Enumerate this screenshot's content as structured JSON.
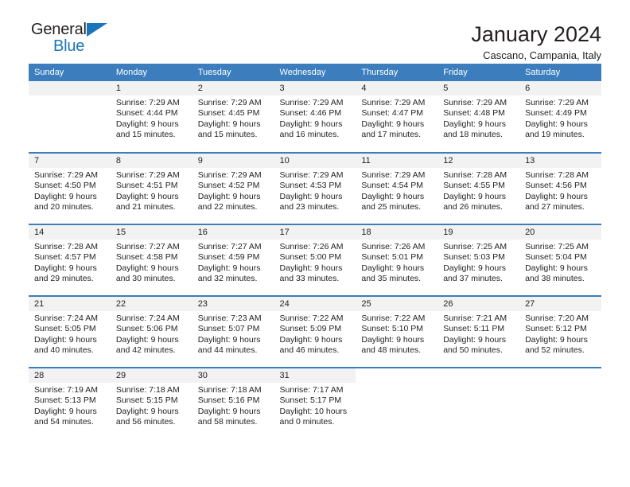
{
  "brand": {
    "name_part1": "General",
    "name_part2": "Blue",
    "accent_color": "#1b75bb"
  },
  "header": {
    "title": "January 2024",
    "subtitle": "Cascano, Campania, Italy"
  },
  "calendar": {
    "header_bg": "#3b7dbd",
    "daynum_bg": "#f2f2f2",
    "weekdays": [
      "Sunday",
      "Monday",
      "Tuesday",
      "Wednesday",
      "Thursday",
      "Friday",
      "Saturday"
    ],
    "weeks": [
      [
        {
          "day": "",
          "sunrise": "",
          "sunset": "",
          "daylight_line1": "",
          "daylight_line2": ""
        },
        {
          "day": "1",
          "sunrise": "Sunrise: 7:29 AM",
          "sunset": "Sunset: 4:44 PM",
          "daylight_line1": "Daylight: 9 hours",
          "daylight_line2": "and 15 minutes."
        },
        {
          "day": "2",
          "sunrise": "Sunrise: 7:29 AM",
          "sunset": "Sunset: 4:45 PM",
          "daylight_line1": "Daylight: 9 hours",
          "daylight_line2": "and 15 minutes."
        },
        {
          "day": "3",
          "sunrise": "Sunrise: 7:29 AM",
          "sunset": "Sunset: 4:46 PM",
          "daylight_line1": "Daylight: 9 hours",
          "daylight_line2": "and 16 minutes."
        },
        {
          "day": "4",
          "sunrise": "Sunrise: 7:29 AM",
          "sunset": "Sunset: 4:47 PM",
          "daylight_line1": "Daylight: 9 hours",
          "daylight_line2": "and 17 minutes."
        },
        {
          "day": "5",
          "sunrise": "Sunrise: 7:29 AM",
          "sunset": "Sunset: 4:48 PM",
          "daylight_line1": "Daylight: 9 hours",
          "daylight_line2": "and 18 minutes."
        },
        {
          "day": "6",
          "sunrise": "Sunrise: 7:29 AM",
          "sunset": "Sunset: 4:49 PM",
          "daylight_line1": "Daylight: 9 hours",
          "daylight_line2": "and 19 minutes."
        }
      ],
      [
        {
          "day": "7",
          "sunrise": "Sunrise: 7:29 AM",
          "sunset": "Sunset: 4:50 PM",
          "daylight_line1": "Daylight: 9 hours",
          "daylight_line2": "and 20 minutes."
        },
        {
          "day": "8",
          "sunrise": "Sunrise: 7:29 AM",
          "sunset": "Sunset: 4:51 PM",
          "daylight_line1": "Daylight: 9 hours",
          "daylight_line2": "and 21 minutes."
        },
        {
          "day": "9",
          "sunrise": "Sunrise: 7:29 AM",
          "sunset": "Sunset: 4:52 PM",
          "daylight_line1": "Daylight: 9 hours",
          "daylight_line2": "and 22 minutes."
        },
        {
          "day": "10",
          "sunrise": "Sunrise: 7:29 AM",
          "sunset": "Sunset: 4:53 PM",
          "daylight_line1": "Daylight: 9 hours",
          "daylight_line2": "and 23 minutes."
        },
        {
          "day": "11",
          "sunrise": "Sunrise: 7:29 AM",
          "sunset": "Sunset: 4:54 PM",
          "daylight_line1": "Daylight: 9 hours",
          "daylight_line2": "and 25 minutes."
        },
        {
          "day": "12",
          "sunrise": "Sunrise: 7:28 AM",
          "sunset": "Sunset: 4:55 PM",
          "daylight_line1": "Daylight: 9 hours",
          "daylight_line2": "and 26 minutes."
        },
        {
          "day": "13",
          "sunrise": "Sunrise: 7:28 AM",
          "sunset": "Sunset: 4:56 PM",
          "daylight_line1": "Daylight: 9 hours",
          "daylight_line2": "and 27 minutes."
        }
      ],
      [
        {
          "day": "14",
          "sunrise": "Sunrise: 7:28 AM",
          "sunset": "Sunset: 4:57 PM",
          "daylight_line1": "Daylight: 9 hours",
          "daylight_line2": "and 29 minutes."
        },
        {
          "day": "15",
          "sunrise": "Sunrise: 7:27 AM",
          "sunset": "Sunset: 4:58 PM",
          "daylight_line1": "Daylight: 9 hours",
          "daylight_line2": "and 30 minutes."
        },
        {
          "day": "16",
          "sunrise": "Sunrise: 7:27 AM",
          "sunset": "Sunset: 4:59 PM",
          "daylight_line1": "Daylight: 9 hours",
          "daylight_line2": "and 32 minutes."
        },
        {
          "day": "17",
          "sunrise": "Sunrise: 7:26 AM",
          "sunset": "Sunset: 5:00 PM",
          "daylight_line1": "Daylight: 9 hours",
          "daylight_line2": "and 33 minutes."
        },
        {
          "day": "18",
          "sunrise": "Sunrise: 7:26 AM",
          "sunset": "Sunset: 5:01 PM",
          "daylight_line1": "Daylight: 9 hours",
          "daylight_line2": "and 35 minutes."
        },
        {
          "day": "19",
          "sunrise": "Sunrise: 7:25 AM",
          "sunset": "Sunset: 5:03 PM",
          "daylight_line1": "Daylight: 9 hours",
          "daylight_line2": "and 37 minutes."
        },
        {
          "day": "20",
          "sunrise": "Sunrise: 7:25 AM",
          "sunset": "Sunset: 5:04 PM",
          "daylight_line1": "Daylight: 9 hours",
          "daylight_line2": "and 38 minutes."
        }
      ],
      [
        {
          "day": "21",
          "sunrise": "Sunrise: 7:24 AM",
          "sunset": "Sunset: 5:05 PM",
          "daylight_line1": "Daylight: 9 hours",
          "daylight_line2": "and 40 minutes."
        },
        {
          "day": "22",
          "sunrise": "Sunrise: 7:24 AM",
          "sunset": "Sunset: 5:06 PM",
          "daylight_line1": "Daylight: 9 hours",
          "daylight_line2": "and 42 minutes."
        },
        {
          "day": "23",
          "sunrise": "Sunrise: 7:23 AM",
          "sunset": "Sunset: 5:07 PM",
          "daylight_line1": "Daylight: 9 hours",
          "daylight_line2": "and 44 minutes."
        },
        {
          "day": "24",
          "sunrise": "Sunrise: 7:22 AM",
          "sunset": "Sunset: 5:09 PM",
          "daylight_line1": "Daylight: 9 hours",
          "daylight_line2": "and 46 minutes."
        },
        {
          "day": "25",
          "sunrise": "Sunrise: 7:22 AM",
          "sunset": "Sunset: 5:10 PM",
          "daylight_line1": "Daylight: 9 hours",
          "daylight_line2": "and 48 minutes."
        },
        {
          "day": "26",
          "sunrise": "Sunrise: 7:21 AM",
          "sunset": "Sunset: 5:11 PM",
          "daylight_line1": "Daylight: 9 hours",
          "daylight_line2": "and 50 minutes."
        },
        {
          "day": "27",
          "sunrise": "Sunrise: 7:20 AM",
          "sunset": "Sunset: 5:12 PM",
          "daylight_line1": "Daylight: 9 hours",
          "daylight_line2": "and 52 minutes."
        }
      ],
      [
        {
          "day": "28",
          "sunrise": "Sunrise: 7:19 AM",
          "sunset": "Sunset: 5:13 PM",
          "daylight_line1": "Daylight: 9 hours",
          "daylight_line2": "and 54 minutes."
        },
        {
          "day": "29",
          "sunrise": "Sunrise: 7:18 AM",
          "sunset": "Sunset: 5:15 PM",
          "daylight_line1": "Daylight: 9 hours",
          "daylight_line2": "and 56 minutes."
        },
        {
          "day": "30",
          "sunrise": "Sunrise: 7:18 AM",
          "sunset": "Sunset: 5:16 PM",
          "daylight_line1": "Daylight: 9 hours",
          "daylight_line2": "and 58 minutes."
        },
        {
          "day": "31",
          "sunrise": "Sunrise: 7:17 AM",
          "sunset": "Sunset: 5:17 PM",
          "daylight_line1": "Daylight: 10 hours",
          "daylight_line2": "and 0 minutes."
        },
        {
          "day": "",
          "sunrise": "",
          "sunset": "",
          "daylight_line1": "",
          "daylight_line2": ""
        },
        {
          "day": "",
          "sunrise": "",
          "sunset": "",
          "daylight_line1": "",
          "daylight_line2": ""
        },
        {
          "day": "",
          "sunrise": "",
          "sunset": "",
          "daylight_line1": "",
          "daylight_line2": ""
        }
      ]
    ]
  }
}
